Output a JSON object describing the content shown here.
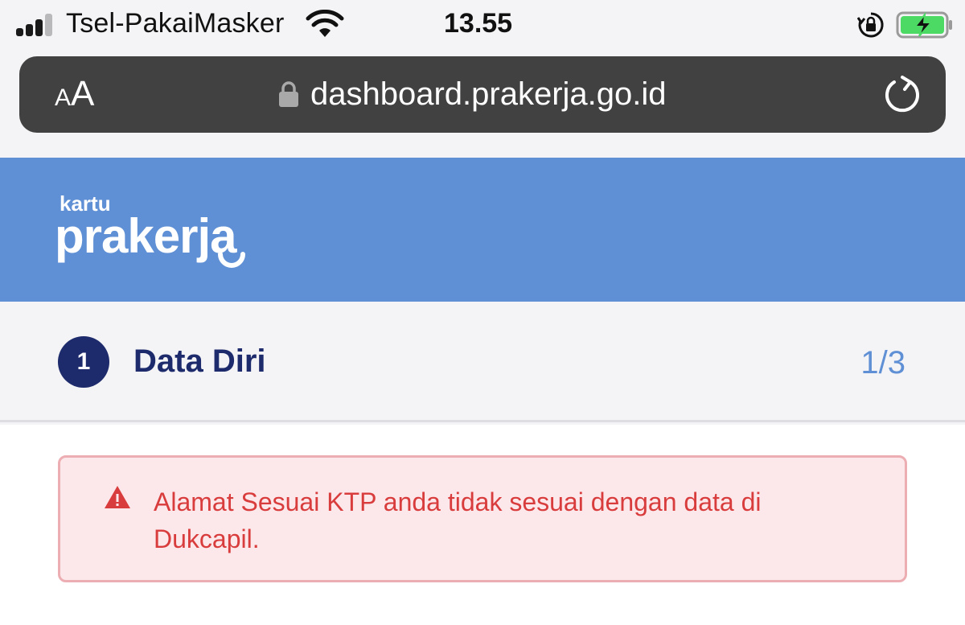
{
  "status_bar": {
    "carrier": "Tsel-PakaiMasker",
    "time": "13.55"
  },
  "browser": {
    "text_size_label": "AA",
    "url": "dashboard.prakerja.go.id"
  },
  "header": {
    "logo_small": "kartu",
    "logo_large": "prakerja"
  },
  "step": {
    "number": "1",
    "title": "Data Diri",
    "progress": "1/3"
  },
  "alert": {
    "message": "Alamat Sesuai KTP anda tidak sesuai dengan data di Dukcapil."
  },
  "colors": {
    "header_blue": "#5f8fd4",
    "navy": "#1d2a6b",
    "alert_red": "#d93c3c",
    "alert_bg": "#fce8ea"
  }
}
